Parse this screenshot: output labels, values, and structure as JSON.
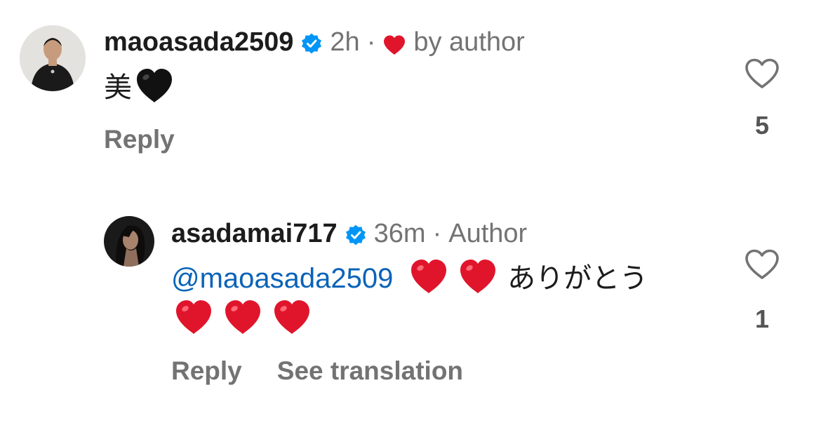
{
  "comments": [
    {
      "username": "maoasada2509",
      "time": "2h",
      "liked_by_author_label": "by author",
      "text_prefix": "美",
      "text_emoji": "black-heart",
      "reply_label": "Reply",
      "like_count": "5"
    },
    {
      "username": "asadamai717",
      "time": "36m",
      "author_badge": "Author",
      "mention": "@maoasada2509",
      "text_suffix": "ありがとう",
      "reply_label": "Reply",
      "translate_label": "See translation",
      "like_count": "1"
    }
  ],
  "colors": {
    "verified_blue": "#0095f6",
    "mention_blue": "#0a63b8",
    "heart_red": "#e0152b",
    "muted_text": "#737373"
  }
}
